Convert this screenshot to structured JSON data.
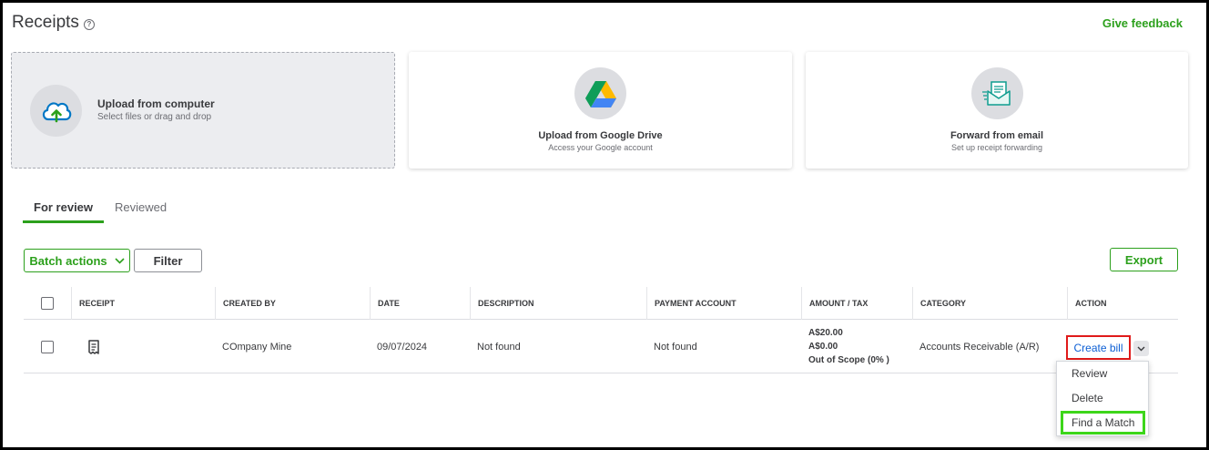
{
  "page": {
    "title": "Receipts",
    "help_icon": "question-circle-icon",
    "feedback_link": "Give feedback"
  },
  "upload_options": [
    {
      "title": "Upload from computer",
      "subtitle": "Select files or drag and drop",
      "icon": "cloud-upload-icon"
    },
    {
      "title": "Upload from Google Drive",
      "subtitle": "Access your Google account",
      "icon": "google-drive-icon"
    },
    {
      "title": "Forward from email",
      "subtitle": "Set up receipt forwarding",
      "icon": "email-forward-icon"
    }
  ],
  "tabs": [
    {
      "label": "For review",
      "active": true
    },
    {
      "label": "Reviewed",
      "active": false
    }
  ],
  "toolbar": {
    "batch_actions": "Batch actions",
    "filter": "Filter",
    "export": "Export"
  },
  "table": {
    "columns": [
      "RECEIPT",
      "CREATED BY",
      "DATE",
      "DESCRIPTION",
      "PAYMENT ACCOUNT",
      "AMOUNT / TAX",
      "CATEGORY",
      "ACTION"
    ],
    "rows": [
      {
        "created_by": "COmpany Mine",
        "date": "09/07/2024",
        "description": "Not found",
        "payment_account": "Not found",
        "amount": "A$20.00",
        "tax": "A$0.00",
        "tax_scope": "Out of Scope (0% )",
        "category": "Accounts Receivable (A/R)",
        "action": "Create bill"
      }
    ]
  },
  "action_menu": {
    "items": [
      "Review",
      "Delete",
      "Find a Match"
    ]
  },
  "colors": {
    "brand_green": "#2ca01c",
    "link_blue": "#0d5fd4",
    "highlight_red": "#e01a1a",
    "highlight_green": "#3dd61a"
  }
}
